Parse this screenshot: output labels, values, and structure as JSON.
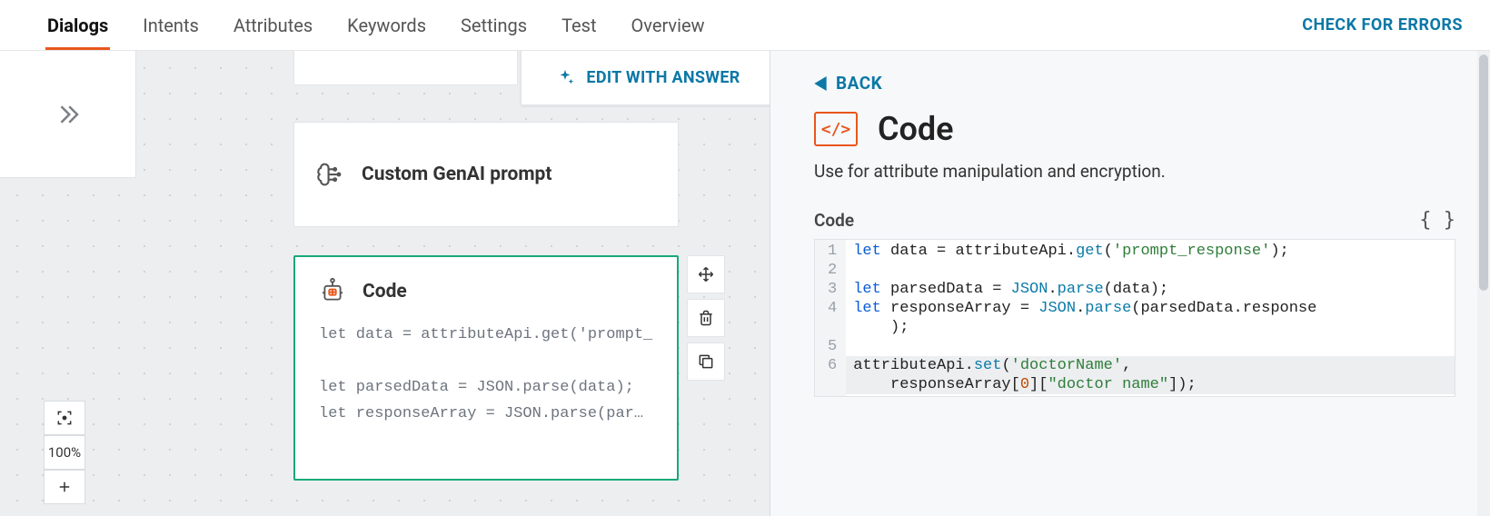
{
  "tabs": {
    "items": [
      "Dialogs",
      "Intents",
      "Attributes",
      "Keywords",
      "Settings",
      "Test",
      "Overview"
    ],
    "active_index": 0
  },
  "header": {
    "check_errors_label": "CHECK FOR ERRORS"
  },
  "canvas": {
    "edit_with_answer_label": "EDIT WITH ANSWER",
    "node_prompt": {
      "title": "Custom GenAI prompt"
    },
    "node_code": {
      "title": "Code",
      "snippet_lines": [
        "let data = attributeApi.get('prompt_",
        "",
        "let parsedData = JSON.parse(data);",
        "let responseArray = JSON.parse(par…"
      ]
    },
    "zoom_label": "100%"
  },
  "detail": {
    "back_label": "BACK",
    "title": "Code",
    "description": "Use for attribute manipulation and encryption.",
    "editor_label": "Code",
    "code_lines": [
      {
        "n": 1,
        "tokens": [
          {
            "t": "let ",
            "c": "kw"
          },
          {
            "t": "data ",
            "c": "id"
          },
          {
            "t": "= ",
            "c": "id"
          },
          {
            "t": "attributeApi",
            "c": "id"
          },
          {
            "t": ".",
            "c": "id"
          },
          {
            "t": "get",
            "c": "cls"
          },
          {
            "t": "(",
            "c": "id"
          },
          {
            "t": "'prompt_response'",
            "c": "str"
          },
          {
            "t": ");",
            "c": "id"
          }
        ]
      },
      {
        "n": 2,
        "tokens": []
      },
      {
        "n": 3,
        "tokens": [
          {
            "t": "let ",
            "c": "kw"
          },
          {
            "t": "parsedData ",
            "c": "id"
          },
          {
            "t": "= ",
            "c": "id"
          },
          {
            "t": "JSON",
            "c": "cls"
          },
          {
            "t": ".",
            "c": "id"
          },
          {
            "t": "parse",
            "c": "cls"
          },
          {
            "t": "(",
            "c": "id"
          },
          {
            "t": "data",
            "c": "id"
          },
          {
            "t": ");",
            "c": "id"
          }
        ]
      },
      {
        "n": 4,
        "tokens": [
          {
            "t": "let ",
            "c": "kw"
          },
          {
            "t": "responseArray ",
            "c": "id"
          },
          {
            "t": "= ",
            "c": "id"
          },
          {
            "t": "JSON",
            "c": "cls"
          },
          {
            "t": ".",
            "c": "id"
          },
          {
            "t": "parse",
            "c": "cls"
          },
          {
            "t": "(",
            "c": "id"
          },
          {
            "t": "parsedData",
            "c": "id"
          },
          {
            "t": ".",
            "c": "id"
          },
          {
            "t": "response",
            "c": "id"
          }
        ]
      },
      {
        "n": null,
        "wrap_of": 4,
        "tokens": [
          {
            "t": "    );",
            "c": "id"
          }
        ]
      },
      {
        "n": 5,
        "tokens": []
      },
      {
        "n": 6,
        "hl": true,
        "tokens": [
          {
            "t": "attributeApi",
            "c": "id"
          },
          {
            "t": ".",
            "c": "id"
          },
          {
            "t": "set",
            "c": "cls"
          },
          {
            "t": "(",
            "c": "id"
          },
          {
            "t": "'doctorName'",
            "c": "str"
          },
          {
            "t": ", ",
            "c": "id"
          }
        ]
      },
      {
        "n": null,
        "wrap_of": 6,
        "hl": true,
        "tokens": [
          {
            "t": "    responseArray",
            "c": "id"
          },
          {
            "t": "[",
            "c": "id"
          },
          {
            "t": "0",
            "c": "num"
          },
          {
            "t": "][",
            "c": "id"
          },
          {
            "t": "\"doctor name\"",
            "c": "str"
          },
          {
            "t": "]);",
            "c": "id"
          }
        ]
      }
    ]
  }
}
